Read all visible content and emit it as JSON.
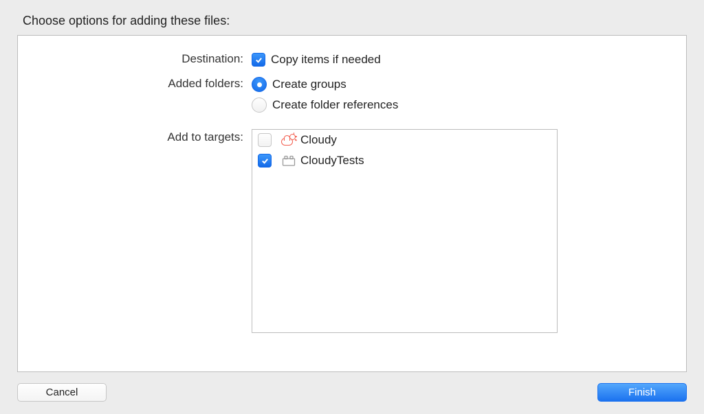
{
  "heading": "Choose options for adding these files:",
  "destination": {
    "label": "Destination:",
    "copy_items_label": "Copy items if needed",
    "copy_items_checked": true
  },
  "added_folders": {
    "label": "Added folders:",
    "create_groups_label": "Create groups",
    "create_references_label": "Create folder references",
    "selected": "create_groups"
  },
  "add_to_targets": {
    "label": "Add to targets:",
    "targets": [
      {
        "name": "Cloudy",
        "icon": "cloud-sun-icon",
        "checked": false
      },
      {
        "name": "CloudyTests",
        "icon": "blocks-icon",
        "checked": true
      }
    ]
  },
  "buttons": {
    "cancel": "Cancel",
    "finish": "Finish"
  }
}
